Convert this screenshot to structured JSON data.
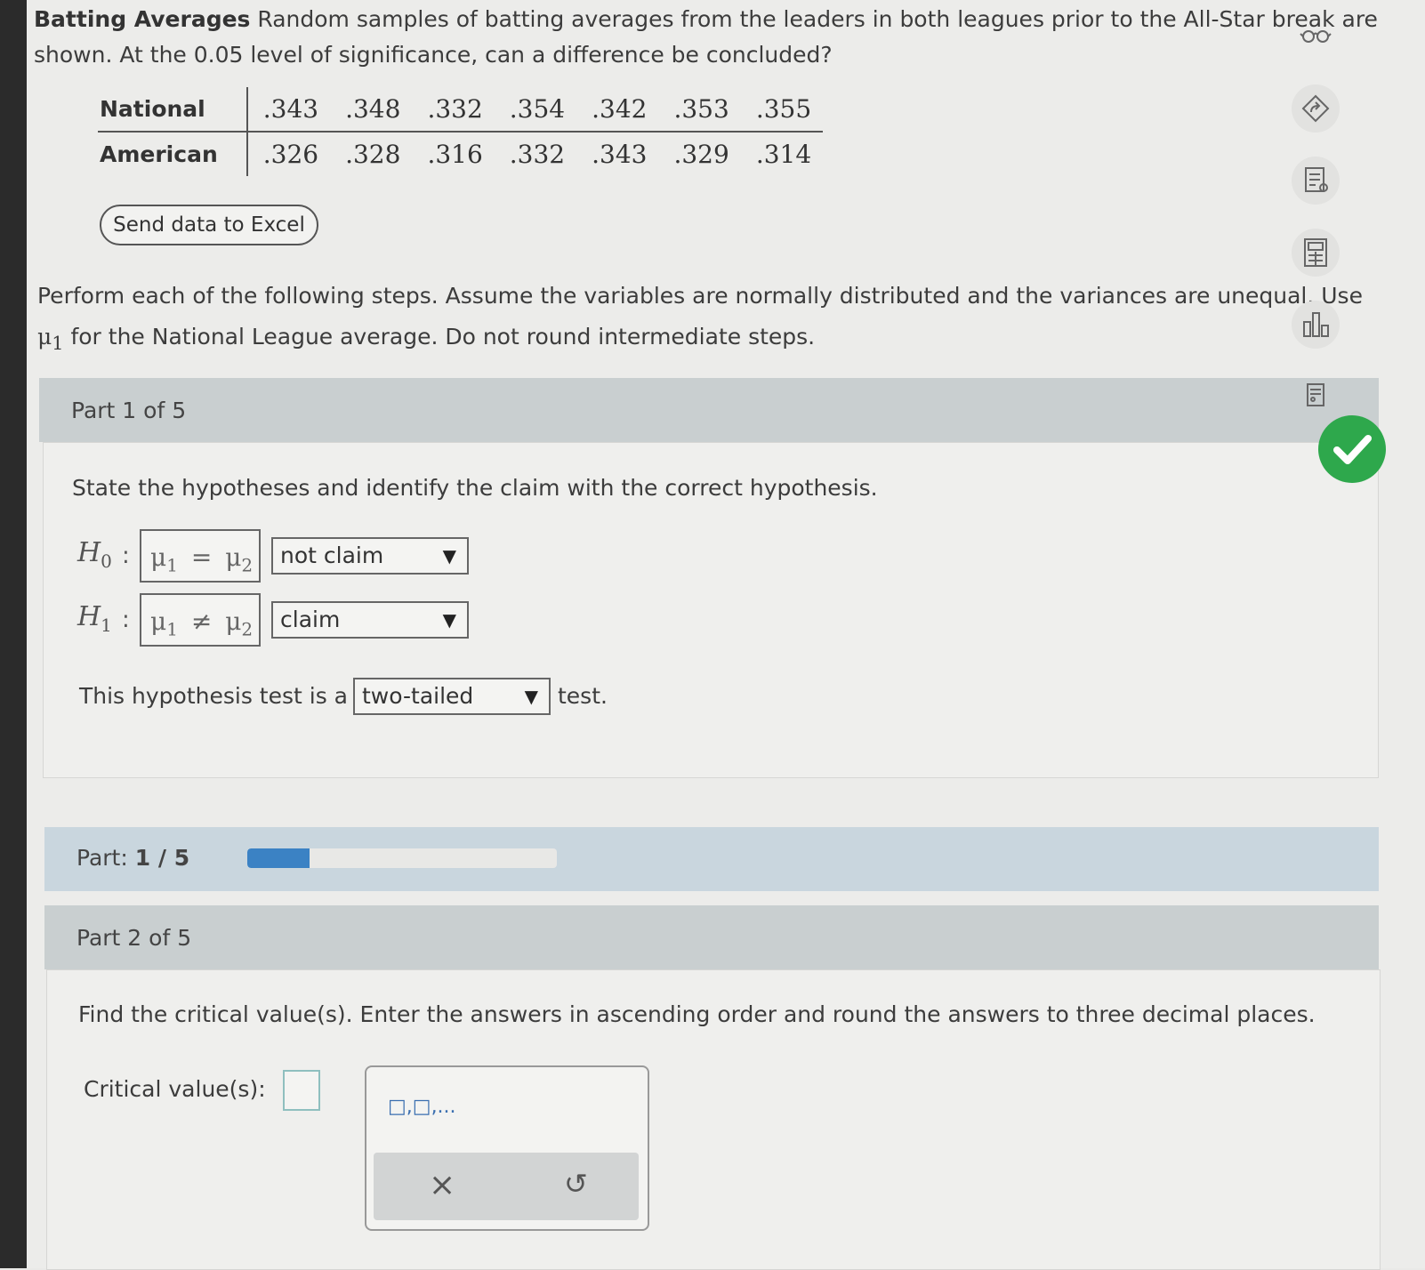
{
  "problem": {
    "title": "Batting Averages",
    "intro_text": " Random samples of batting averages from the leaders in both leagues prior to the All-Star break are shown. At the 0.05 level of significance, can a difference be concluded?"
  },
  "table": {
    "rows": [
      {
        "label": "National",
        "values": [
          ".343",
          ".348",
          ".332",
          ".354",
          ".342",
          ".353",
          ".355"
        ]
      },
      {
        "label": "American",
        "values": [
          ".326",
          ".328",
          ".316",
          ".332",
          ".343",
          ".329",
          ".314"
        ]
      }
    ]
  },
  "excel_button_label": "Send data to Excel",
  "instructions": {
    "part_a": "Perform each of the following steps. Assume the variables are normally distributed and the variances are unequal. Use ",
    "mu": "μ",
    "mu_sub": "1",
    "part_b": " for the National League average. Do not round intermediate steps."
  },
  "part1": {
    "header": "Part 1 of 5",
    "prompt": "State the hypotheses and identify the claim with the correct hypothesis.",
    "h0": {
      "label": "H",
      "sub": "0",
      "colon": ":",
      "expr_left": "μ",
      "expr_left_sub": "1",
      "op": "=",
      "expr_right": "μ",
      "expr_right_sub": "2",
      "claim_select": "not claim"
    },
    "h1": {
      "label": "H",
      "sub": "1",
      "colon": ":",
      "expr_left": "μ",
      "expr_left_sub": "1",
      "op": "≠",
      "expr_right": "μ",
      "expr_right_sub": "2",
      "claim_select": "claim"
    },
    "test_type_prefix": "This hypothesis test is a",
    "test_type_select": "two-tailed",
    "test_type_suffix": "test."
  },
  "progress": {
    "label": "Part: ",
    "current": "1",
    "separator": " / ",
    "total": "5",
    "fraction": 0.2
  },
  "part2": {
    "header": "Part 2 of 5",
    "prompt": "Find the critical value(s). Enter the answers in ascending order and round the answers to three decimal places.",
    "critical_label": "Critical value(s):",
    "palette_glyph": "□,□,...",
    "palette_clear": "×",
    "palette_undo": "↺"
  },
  "icons": {
    "side": [
      "glasses-icon",
      "share-icon",
      "notes-icon",
      "calculator-icon",
      "chart-icon",
      "worksheet-icon"
    ],
    "status": "check-icon",
    "check_color": "#2ea84c",
    "progress_color": "#3b82c4"
  }
}
